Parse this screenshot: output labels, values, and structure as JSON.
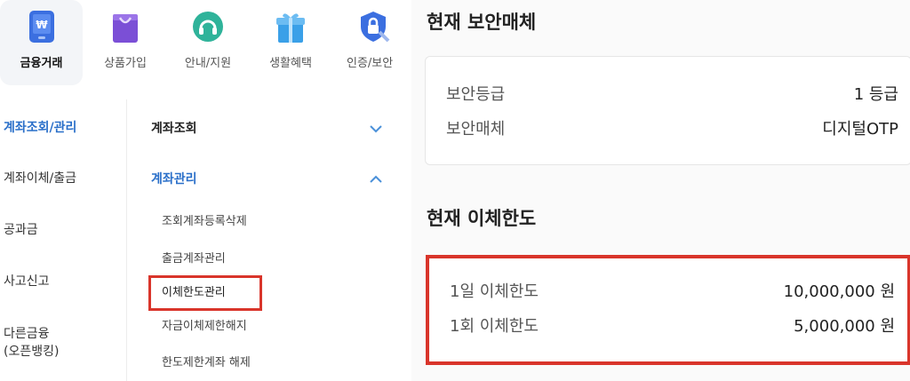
{
  "top_categories": [
    {
      "label": "금융거래",
      "icon": "finance-app-icon",
      "active": true,
      "color": "#3b6fe0"
    },
    {
      "label": "상품가입",
      "icon": "shopping-bag-icon",
      "active": false,
      "color": "#7b4fd6"
    },
    {
      "label": "안내/지원",
      "icon": "headset-support-icon",
      "active": false,
      "color": "#2fb39a"
    },
    {
      "label": "생활혜택",
      "icon": "gift-box-icon",
      "active": false,
      "color": "#3aa0e8"
    },
    {
      "label": "인증/보안",
      "icon": "shield-lock-icon",
      "active": false,
      "color": "#3b6fe0"
    }
  ],
  "sidebar": {
    "items": [
      {
        "label": "계좌조회/관리",
        "active": true
      },
      {
        "label": "계좌이체/출금",
        "active": false
      },
      {
        "label": "공과금",
        "active": false
      },
      {
        "label": "사고신고",
        "active": false
      },
      {
        "label": "다른금융\n(오픈뱅킹)",
        "active": false
      }
    ]
  },
  "submenu": {
    "sections": [
      {
        "label": "계좌조회",
        "expanded": false
      },
      {
        "label": "계좌관리",
        "expanded": true
      }
    ],
    "items": [
      "조회계좌등록삭제",
      "출금계좌관리",
      "이체한도관리",
      "자금이체제한해지",
      "한도제한계좌 해제"
    ],
    "highlighted_index": 2
  },
  "security": {
    "title": "현재 보안매체",
    "rows": [
      {
        "label": "보안등급",
        "value": "1 등급"
      },
      {
        "label": "보안매체",
        "value": "디지털OTP"
      }
    ]
  },
  "transfer_limit": {
    "title": "현재 이체한도",
    "rows": [
      {
        "label": "1일 이체한도",
        "value": "10,000,000 원"
      },
      {
        "label": "1회 이체한도",
        "value": "5,000,000 원"
      }
    ]
  },
  "colors": {
    "accent_blue": "#2a6fc9",
    "highlight_red": "#d9352b",
    "chevron": "#4a90d9"
  }
}
